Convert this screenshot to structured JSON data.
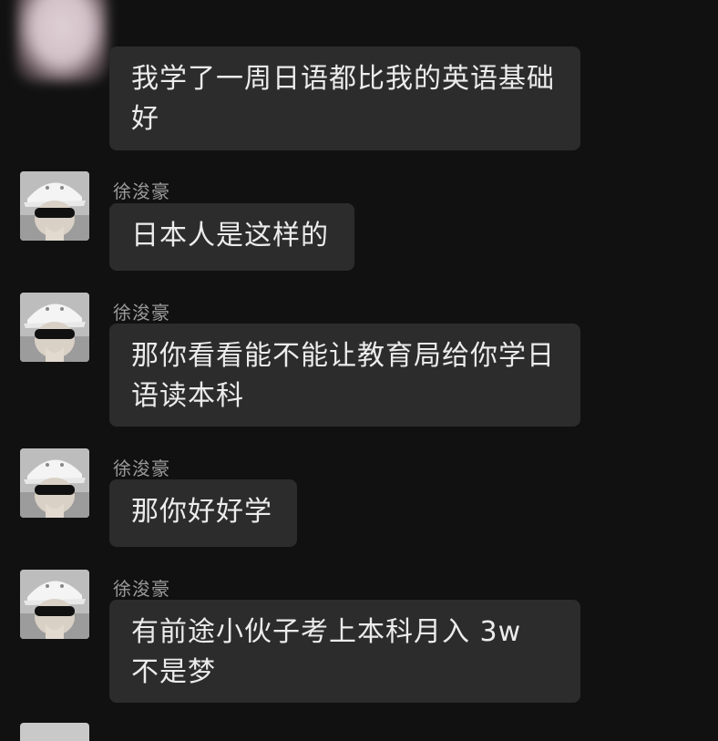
{
  "chat": {
    "messages": [
      {
        "sender": "",
        "text": "我学了一周日语都比我的英语基础好"
      },
      {
        "sender": "徐浚豪",
        "text": "日本人是这样的"
      },
      {
        "sender": "徐浚豪",
        "text": "那你看看能不能让教育局给你学日语读本科"
      },
      {
        "sender": "徐浚豪",
        "text": "那你好好学"
      },
      {
        "sender": "徐浚豪",
        "text": "有前途小伙子考上本科月入 3w 不是梦"
      }
    ]
  },
  "icons": {
    "avatar_top": "blurred-avatar-icon",
    "avatar_user": "cap-sunglasses-avatar-icon"
  }
}
